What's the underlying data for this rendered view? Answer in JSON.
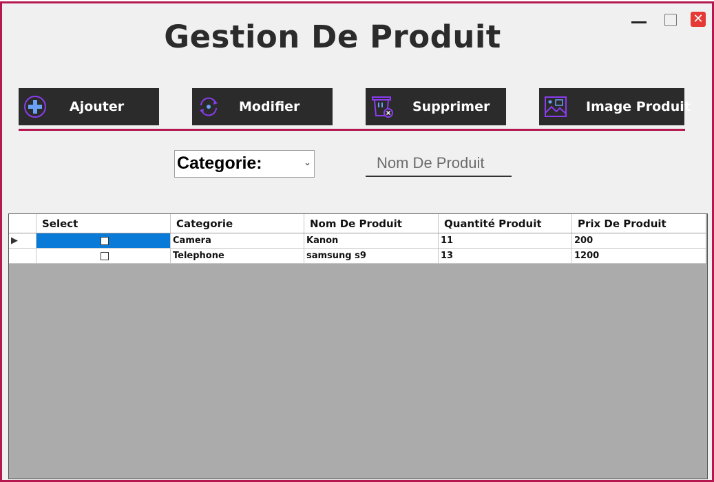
{
  "window": {
    "title": "Gestion De Produit",
    "controls": {
      "minimize": "minimize-icon",
      "maximize": "maximize-icon",
      "close": "✕"
    },
    "accent_color": "#b5174f",
    "close_color": "#e53935"
  },
  "toolbar": {
    "add_label": "Ajouter",
    "modify_label": "Modifier",
    "delete_label": "Supprimer",
    "image_label": "Image Produit",
    "button_bg": "#2c2b2b",
    "icon_color": "#8a3cf0"
  },
  "filters": {
    "category_value": "Categorie:",
    "category_arrow": "⌄",
    "name_placeholder": "Nom De Produit"
  },
  "table": {
    "columns": [
      "Select",
      "Categorie",
      "Nom De Produit",
      "Quantité Produit",
      "Prix De Produit"
    ],
    "current_row_marker": "▶",
    "rows": [
      {
        "selected": true,
        "categorie": "Camera",
        "nom": "Kanon",
        "quantite": "11",
        "prix": "200"
      },
      {
        "selected": false,
        "categorie": "Telephone",
        "nom": "samsung s9",
        "quantite": "13",
        "prix": "1200"
      }
    ],
    "selection_color": "#0a7ad8"
  }
}
